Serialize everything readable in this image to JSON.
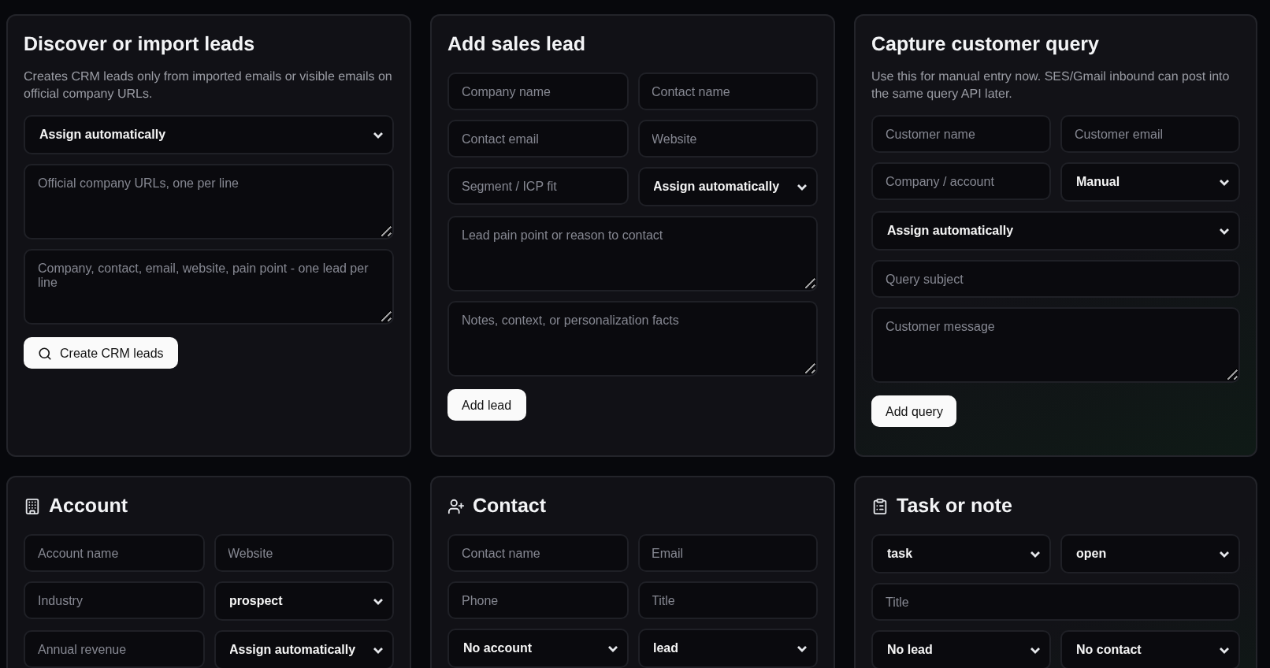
{
  "top_cards": [
    {
      "title": "Discover or import leads",
      "description": "Creates CRM leads only from imported emails or visible emails on official company URLs.",
      "rows": [
        [
          {
            "kind": "select",
            "value": "Assign automatically"
          }
        ],
        [
          {
            "kind": "textarea",
            "placeholder": "Official company URLs, one per line"
          }
        ],
        [
          {
            "kind": "textarea",
            "placeholder": "Company, contact, email, website, pain point - one lead per line"
          }
        ]
      ],
      "button": {
        "label": "Create CRM leads",
        "kind": "search"
      }
    },
    {
      "title": "Add sales lead",
      "rows": [
        [
          {
            "kind": "input",
            "placeholder": "Company name"
          },
          {
            "kind": "input",
            "placeholder": "Contact name"
          }
        ],
        [
          {
            "kind": "input",
            "placeholder": "Contact email"
          },
          {
            "kind": "input",
            "placeholder": "Website"
          }
        ],
        [
          {
            "kind": "input",
            "placeholder": "Segment / ICP fit"
          },
          {
            "kind": "select",
            "value": "Assign automatically"
          }
        ],
        [
          {
            "kind": "textarea",
            "placeholder": "Lead pain point or reason to contact"
          }
        ],
        [
          {
            "kind": "textarea",
            "placeholder": "Notes, context, or personalization facts"
          }
        ]
      ],
      "button": {
        "label": "Add lead",
        "kind": "plain"
      }
    },
    {
      "title": "Capture customer query",
      "description": "Use this for manual entry now. SES/Gmail inbound can post into the same query API later.",
      "rows": [
        [
          {
            "kind": "input",
            "placeholder": "Customer name"
          },
          {
            "kind": "input",
            "placeholder": "Customer email"
          }
        ],
        [
          {
            "kind": "input",
            "placeholder": "Company / account"
          },
          {
            "kind": "select",
            "value": "Manual"
          }
        ],
        [
          {
            "kind": "select",
            "value": "Assign automatically"
          }
        ],
        [
          {
            "kind": "input",
            "placeholder": "Query subject"
          }
        ],
        [
          {
            "kind": "textarea",
            "placeholder": "Customer message"
          }
        ]
      ],
      "button": {
        "label": "Add query",
        "kind": "plain"
      }
    }
  ],
  "bottom_cards": [
    {
      "title": "Account",
      "rows": [
        [
          {
            "kind": "input",
            "placeholder": "Account name"
          },
          {
            "kind": "input",
            "placeholder": "Website"
          }
        ],
        [
          {
            "kind": "input",
            "placeholder": "Industry"
          },
          {
            "kind": "select",
            "value": "prospect"
          }
        ],
        [
          {
            "kind": "input",
            "placeholder": "Annual revenue"
          },
          {
            "kind": "select",
            "value": "Assign automatically"
          }
        ]
      ]
    },
    {
      "title": "Contact",
      "rows": [
        [
          {
            "kind": "input",
            "placeholder": "Contact name"
          },
          {
            "kind": "input",
            "placeholder": "Email"
          }
        ],
        [
          {
            "kind": "input",
            "placeholder": "Phone"
          },
          {
            "kind": "input",
            "placeholder": "Title"
          }
        ],
        [
          {
            "kind": "select",
            "value": "No account"
          },
          {
            "kind": "select",
            "value": "lead"
          }
        ]
      ]
    },
    {
      "title": "Task or note",
      "rows": [
        [
          {
            "kind": "select",
            "value": "task"
          },
          {
            "kind": "select",
            "value": "open"
          }
        ],
        [
          {
            "kind": "input",
            "placeholder": "Title"
          }
        ],
        [
          {
            "kind": "select",
            "value": "No lead"
          },
          {
            "kind": "select",
            "value": "No contact"
          }
        ]
      ]
    }
  ]
}
